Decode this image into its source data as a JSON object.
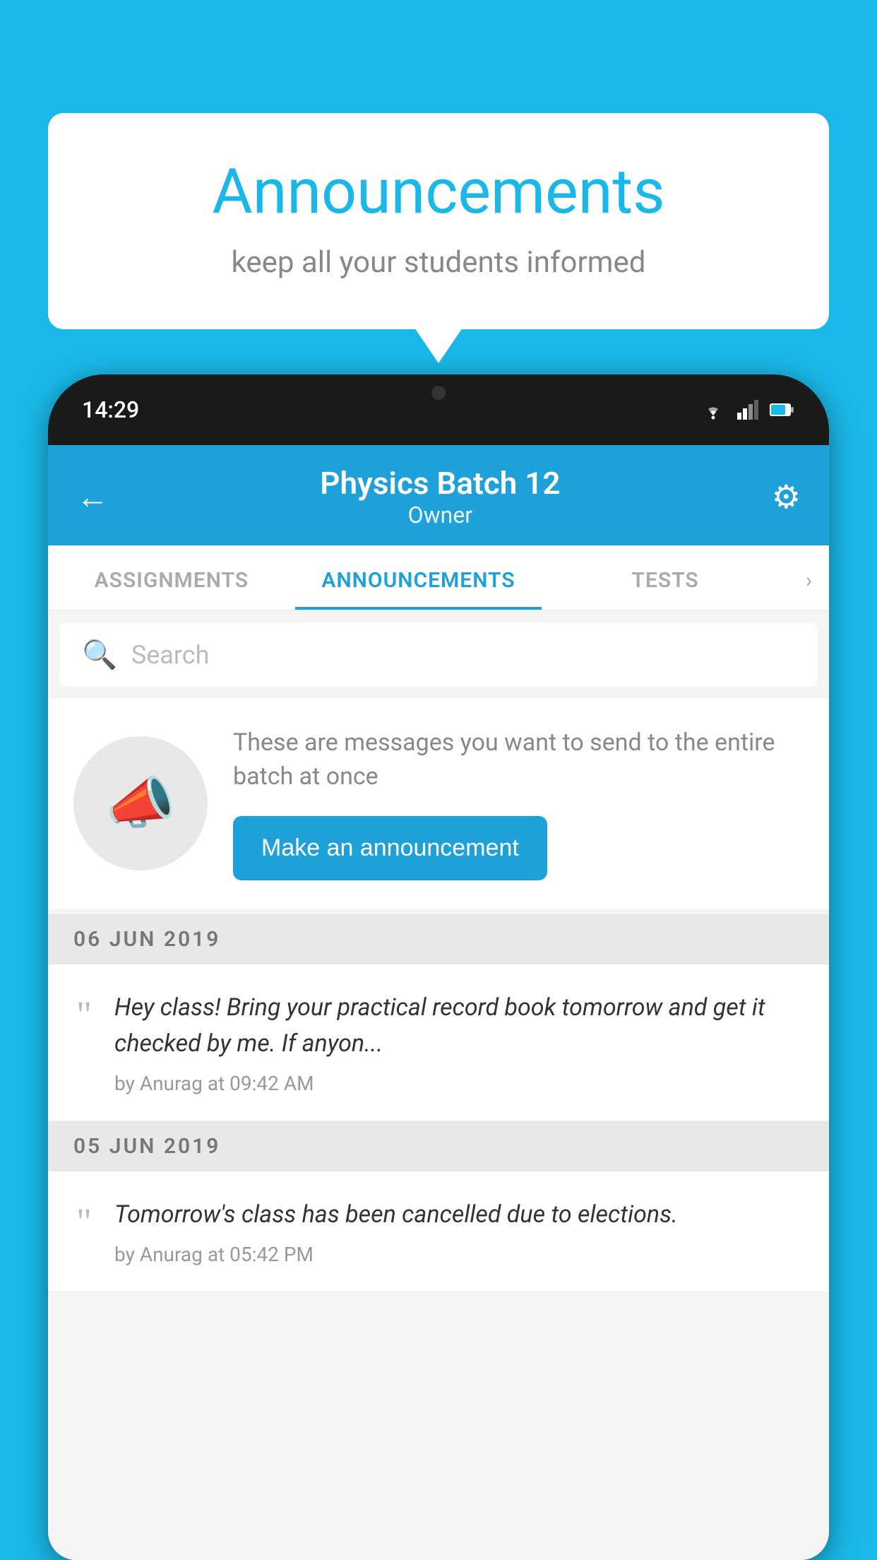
{
  "background_color": "#1ab8e8",
  "speech_bubble": {
    "title": "Announcements",
    "subtitle": "keep all your students informed"
  },
  "phone": {
    "status_bar": {
      "time": "14:29"
    },
    "header": {
      "title": "Physics Batch 12",
      "subtitle": "Owner",
      "back_label": "←"
    },
    "tabs": [
      {
        "label": "ASSIGNMENTS",
        "active": false
      },
      {
        "label": "ANNOUNCEMENTS",
        "active": true
      },
      {
        "label": "TESTS",
        "active": false
      }
    ],
    "search": {
      "placeholder": "Search"
    },
    "prompt": {
      "description": "These are messages you want to send to the entire batch at once",
      "button_label": "Make an announcement"
    },
    "date_sections": [
      {
        "date": "06  JUN  2019",
        "items": [
          {
            "text": "Hey class! Bring your practical record book tomorrow and get it checked by me. If anyon...",
            "meta": "by Anurag at 09:42 AM"
          }
        ]
      },
      {
        "date": "05  JUN  2019",
        "items": [
          {
            "text": "Tomorrow's class has been cancelled due to elections.",
            "meta": "by Anurag at 05:42 PM"
          }
        ]
      }
    ]
  }
}
